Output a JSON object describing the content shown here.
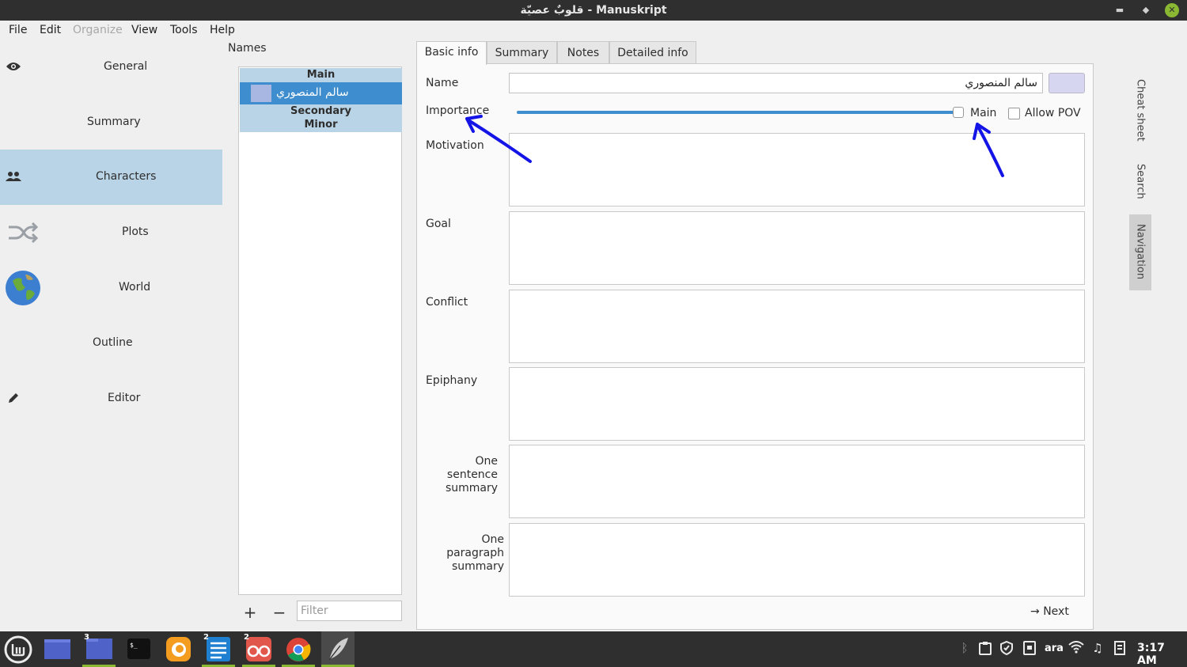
{
  "window": {
    "title": "قلوبٌ عصيّة - Manuskript"
  },
  "menubar": {
    "file": "File",
    "edit": "Edit",
    "organize": "Organize",
    "view": "View",
    "tools": "Tools",
    "help": "Help"
  },
  "nav": {
    "general": "General",
    "summary": "Summary",
    "characters": "Characters",
    "plots": "Plots",
    "world": "World",
    "outline": "Outline",
    "editor": "Editor"
  },
  "names_panel": {
    "title": "Names",
    "groups": [
      "Main",
      "Secondary",
      "Minor"
    ],
    "selected_character": "سالم المنصوري",
    "filter_placeholder": "Filter",
    "add": "+",
    "remove": "−"
  },
  "tabs": [
    "Basic info",
    "Summary",
    "Notes",
    "Detailed info"
  ],
  "form": {
    "name_label": "Name",
    "name_value": "سالم المنصوري",
    "importance_label": "Importance",
    "importance_value": "Main",
    "importance_level": 1.0,
    "allow_pov_label": "Allow POV",
    "allow_pov_checked": false,
    "motivation_label": "Motivation",
    "goal_label": "Goal",
    "conflict_label": "Conflict",
    "epiphany_label": "Epiphany",
    "one_sentence_label_1": "One sentence",
    "one_sentence_label_2": "summary",
    "one_paragraph_label_1": "One paragraph",
    "one_paragraph_label_2": "summary",
    "next_label": "Next",
    "next_icon": "arrow-right-icon",
    "character_color": "#d6d6f0"
  },
  "dock": {
    "cheat_sheet": "Cheat sheet",
    "search": "Search",
    "navigation": "Navigation"
  },
  "taskbar": {
    "lang": "ara",
    "clock": "3:17 AM",
    "badges": {
      "files": "3",
      "text_editor": "2",
      "reader": "2"
    }
  },
  "colors": {
    "accent": "#3e8ecf",
    "selection": "#b9d4e6",
    "mint_green": "#8ab833",
    "annotation": "#1414e6"
  }
}
